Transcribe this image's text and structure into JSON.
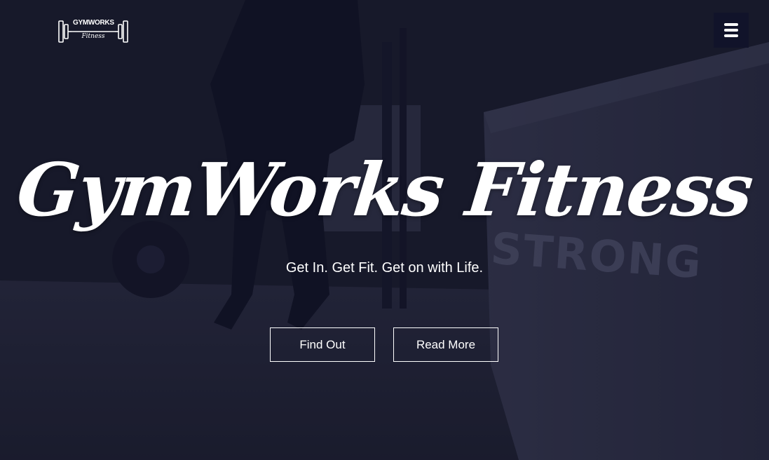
{
  "logo": {
    "text_top": "GYMWORKS",
    "text_bottom": "Fitness",
    "icon": "barbell-logo-icon"
  },
  "nav": {
    "menu_icon": "hamburger-menu-icon"
  },
  "hero": {
    "title": "GymWorks Fitness",
    "tagline": "Get In. Get Fit. Get on with Life.",
    "buttons": [
      {
        "label": "Find Out"
      },
      {
        "label": "Read More"
      }
    ]
  },
  "background": {
    "wall_text": "STRONG"
  },
  "colors": {
    "text": "#ffffff",
    "menu_bg": "#11132a",
    "overlay": "#1c1d2c"
  }
}
